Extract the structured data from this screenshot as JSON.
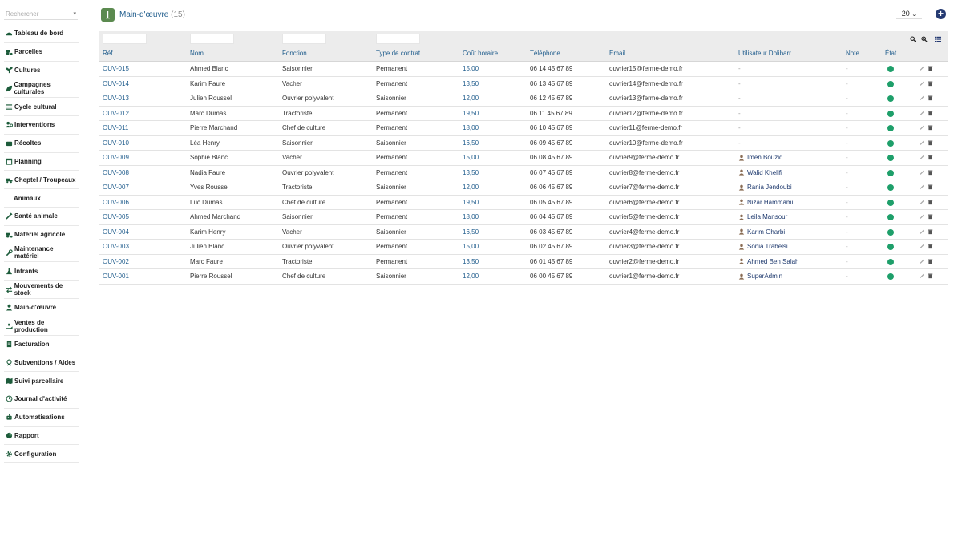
{
  "sidebar": {
    "search_placeholder": "Rechercher",
    "items": [
      {
        "label": "Tableau de bord",
        "icon": "dashboard-icon",
        "sub": false
      },
      {
        "label": "Parcelles",
        "icon": "tractor-icon",
        "sub": false
      },
      {
        "label": "Cultures",
        "icon": "seedling-icon",
        "sub": false
      },
      {
        "label": "Campagnes culturales",
        "icon": "leaf-icon",
        "sub": false
      },
      {
        "label": "Cycle cultural",
        "icon": "list-icon",
        "sub": false
      },
      {
        "label": "Interventions",
        "icon": "users-cog-icon",
        "sub": false
      },
      {
        "label": "Récoltes",
        "icon": "basket-icon",
        "sub": false
      },
      {
        "label": "Planning",
        "icon": "calendar-icon",
        "sub": false
      },
      {
        "label": "Cheptel / Troupeaux",
        "icon": "truck-icon",
        "sub": false
      },
      {
        "label": "Animaux",
        "icon": "",
        "sub": true
      },
      {
        "label": "Santé animale",
        "icon": "syringe-icon",
        "sub": false
      },
      {
        "label": "Matériel agricole",
        "icon": "tractor-icon",
        "sub": false
      },
      {
        "label": "Maintenance matériel",
        "icon": "wrench-icon",
        "sub": false
      },
      {
        "label": "Intrants",
        "icon": "flask-icon",
        "sub": false
      },
      {
        "label": "Mouvements de stock",
        "icon": "exchange-icon",
        "sub": false
      },
      {
        "label": "Main-d'œuvre",
        "icon": "user-icon",
        "sub": false
      },
      {
        "label": "Ventes de production",
        "icon": "hand-holding-icon",
        "sub": false
      },
      {
        "label": "Facturation",
        "icon": "invoice-icon",
        "sub": false
      },
      {
        "label": "Subventions / Aides",
        "icon": "award-icon",
        "sub": false
      },
      {
        "label": "Suivi parcellaire",
        "icon": "map-icon",
        "sub": false
      },
      {
        "label": "Journal d'activité",
        "icon": "history-icon",
        "sub": false
      },
      {
        "label": "Automatisations",
        "icon": "robot-icon",
        "sub": false
      },
      {
        "label": "Rapport",
        "icon": "chart-icon",
        "sub": false
      },
      {
        "label": "Configuration",
        "icon": "gear-icon",
        "sub": false
      }
    ]
  },
  "header": {
    "title": "Main-d'œuvre",
    "count": "(15)",
    "page_size": "20"
  },
  "table": {
    "columns": [
      "Réf.",
      "Nom",
      "Fonction",
      "Type de contrat",
      "Coût horaire",
      "Téléphone",
      "Email",
      "Utilisateur Dolibarr",
      "Note",
      "État"
    ],
    "rows": [
      {
        "ref": "OUV-015",
        "name": "Ahmed Blanc",
        "role": "Saisonnier",
        "contract": "Permanent",
        "rate": "15,00",
        "phone": "06 14 45 67 89",
        "email": "ouvrier15@ferme-demo.fr",
        "user": "-",
        "note": "-"
      },
      {
        "ref": "OUV-014",
        "name": "Karim Faure",
        "role": "Vacher",
        "contract": "Permanent",
        "rate": "13,50",
        "phone": "06 13 45 67 89",
        "email": "ouvrier14@ferme-demo.fr",
        "user": "-",
        "note": "-"
      },
      {
        "ref": "OUV-013",
        "name": "Julien Roussel",
        "role": "Ouvrier polyvalent",
        "contract": "Saisonnier",
        "rate": "12,00",
        "phone": "06 12 45 67 89",
        "email": "ouvrier13@ferme-demo.fr",
        "user": "-",
        "note": "-"
      },
      {
        "ref": "OUV-012",
        "name": "Marc Dumas",
        "role": "Tractoriste",
        "contract": "Permanent",
        "rate": "19,50",
        "phone": "06 11 45 67 89",
        "email": "ouvrier12@ferme-demo.fr",
        "user": "-",
        "note": "-"
      },
      {
        "ref": "OUV-011",
        "name": "Pierre Marchand",
        "role": "Chef de culture",
        "contract": "Permanent",
        "rate": "18,00",
        "phone": "06 10 45 67 89",
        "email": "ouvrier11@ferme-demo.fr",
        "user": "-",
        "note": "-"
      },
      {
        "ref": "OUV-010",
        "name": "Léa Henry",
        "role": "Saisonnier",
        "contract": "Saisonnier",
        "rate": "16,50",
        "phone": "06 09 45 67 89",
        "email": "ouvrier10@ferme-demo.fr",
        "user": "-",
        "note": "-"
      },
      {
        "ref": "OUV-009",
        "name": "Sophie Blanc",
        "role": "Vacher",
        "contract": "Permanent",
        "rate": "15,00",
        "phone": "06 08 45 67 89",
        "email": "ouvrier9@ferme-demo.fr",
        "user": "Imen Bouzid",
        "note": "-"
      },
      {
        "ref": "OUV-008",
        "name": "Nadia Faure",
        "role": "Ouvrier polyvalent",
        "contract": "Permanent",
        "rate": "13,50",
        "phone": "06 07 45 67 89",
        "email": "ouvrier8@ferme-demo.fr",
        "user": "Walid Khelifi",
        "note": "-"
      },
      {
        "ref": "OUV-007",
        "name": "Yves Roussel",
        "role": "Tractoriste",
        "contract": "Saisonnier",
        "rate": "12,00",
        "phone": "06 06 45 67 89",
        "email": "ouvrier7@ferme-demo.fr",
        "user": "Rania Jendoubi",
        "note": "-"
      },
      {
        "ref": "OUV-006",
        "name": "Luc Dumas",
        "role": "Chef de culture",
        "contract": "Permanent",
        "rate": "19,50",
        "phone": "06 05 45 67 89",
        "email": "ouvrier6@ferme-demo.fr",
        "user": "Nizar Hammami",
        "note": "-"
      },
      {
        "ref": "OUV-005",
        "name": "Ahmed Marchand",
        "role": "Saisonnier",
        "contract": "Permanent",
        "rate": "18,00",
        "phone": "06 04 45 67 89",
        "email": "ouvrier5@ferme-demo.fr",
        "user": "Leila Mansour",
        "note": "-"
      },
      {
        "ref": "OUV-004",
        "name": "Karim Henry",
        "role": "Vacher",
        "contract": "Saisonnier",
        "rate": "16,50",
        "phone": "06 03 45 67 89",
        "email": "ouvrier4@ferme-demo.fr",
        "user": "Karim Gharbi",
        "note": "-"
      },
      {
        "ref": "OUV-003",
        "name": "Julien Blanc",
        "role": "Ouvrier polyvalent",
        "contract": "Permanent",
        "rate": "15,00",
        "phone": "06 02 45 67 89",
        "email": "ouvrier3@ferme-demo.fr",
        "user": "Sonia Trabelsi",
        "note": "-"
      },
      {
        "ref": "OUV-002",
        "name": "Marc Faure",
        "role": "Tractoriste",
        "contract": "Permanent",
        "rate": "13,50",
        "phone": "06 01 45 67 89",
        "email": "ouvrier2@ferme-demo.fr",
        "user": "Ahmed Ben Salah",
        "note": "-"
      },
      {
        "ref": "OUV-001",
        "name": "Pierre Roussel",
        "role": "Chef de culture",
        "contract": "Saisonnier",
        "rate": "12,00",
        "phone": "06 00 45 67 89",
        "email": "ouvrier1@ferme-demo.fr",
        "user": "SuperAdmin",
        "note": "-"
      }
    ]
  },
  "colors": {
    "link": "#1f5c8c",
    "status_active": "#1e9f6a",
    "add_button": "#253a72",
    "header_bg": "#ececec"
  }
}
